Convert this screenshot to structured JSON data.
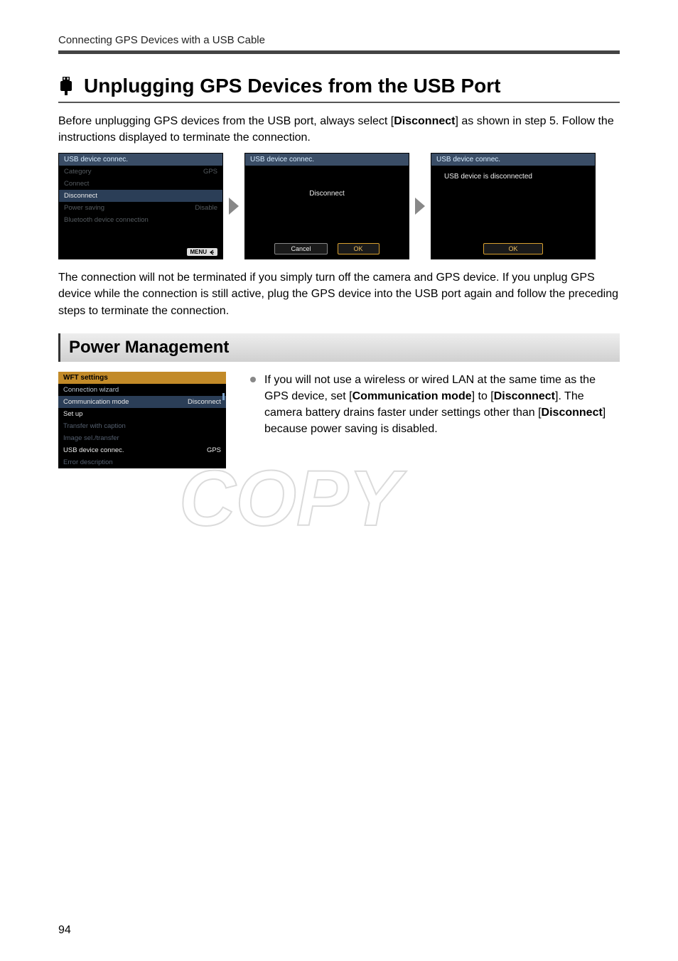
{
  "header": {
    "running": "Connecting GPS Devices with a USB Cable"
  },
  "h1": {
    "title": "Unplugging GPS Devices from the USB Port"
  },
  "intro": {
    "pre": "Before unplugging GPS devices from the USB port, always select [",
    "bold1": "Disconnect",
    "post": "] as shown in step 5. Follow the instructions displayed to terminate the connection."
  },
  "screens": {
    "s1": {
      "title": "USB device connec.",
      "rows": [
        {
          "l": "Category",
          "r": "GPS",
          "cls": ""
        },
        {
          "l": "Connect",
          "r": "",
          "cls": ""
        },
        {
          "l": "Disconnect",
          "r": "",
          "cls": "hl"
        },
        {
          "l": "Power saving",
          "r": "Disable",
          "cls": ""
        },
        {
          "l": "Bluetooth device connection",
          "r": "",
          "cls": ""
        }
      ],
      "menu": "MENU"
    },
    "s2": {
      "title": "USB device connec.",
      "center": "Disconnect",
      "cancel": "Cancel",
      "ok": "OK"
    },
    "s3": {
      "title": "USB device connec.",
      "msg": "USB device is disconnected",
      "ok": "OK"
    }
  },
  "after": "The connection will not be terminated if you simply turn off the camera and GPS device. If you unplug GPS device while the connection is still active, plug the GPS device into the USB port again and follow the preceding steps to terminate the connection.",
  "h2": {
    "title": "Power Management"
  },
  "wft": {
    "title": "WFT settings",
    "rows": [
      {
        "l": "Connection wizard",
        "r": "",
        "cls": ""
      },
      {
        "l": "Communication mode",
        "r": "Disconnect",
        "cls": "hl"
      },
      {
        "l": "Set up",
        "r": "",
        "cls": "white"
      },
      {
        "l": "Transfer with caption",
        "r": "",
        "cls": "dim"
      },
      {
        "l": "Image sel./transfer",
        "r": "",
        "cls": "dim"
      },
      {
        "l": "USB device connec.",
        "r": "GPS",
        "cls": "white"
      },
      {
        "l": "Error description",
        "r": "",
        "cls": "dim"
      }
    ]
  },
  "bullet": {
    "t1": "If you will not use a wireless or wired LAN at the same time as the GPS device, set [",
    "b1": "Communication mode",
    "t2": "] to [",
    "b2": "Disconnect",
    "t3": "]. The camera battery drains faster under settings other than [",
    "b3": "Disconnect",
    "t4": "] because power saving is disabled."
  },
  "watermark": "COPY",
  "pageNumber": "94"
}
